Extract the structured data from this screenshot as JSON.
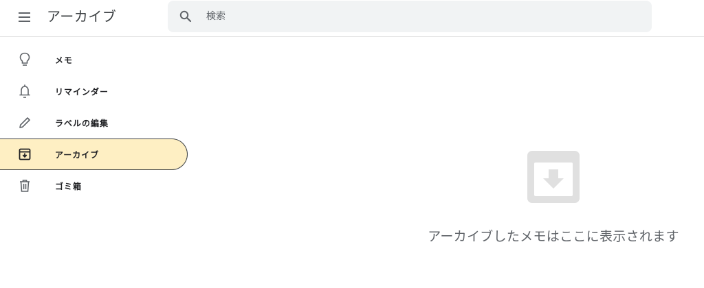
{
  "header": {
    "title": "アーカイブ",
    "menu_icon": "hamburger-menu-icon",
    "search": {
      "placeholder": "検索",
      "value": "",
      "icon": "search-icon"
    }
  },
  "sidebar": {
    "items": [
      {
        "label": "メモ",
        "icon": "lightbulb-icon",
        "active": false
      },
      {
        "label": "リマインダー",
        "icon": "bell-icon",
        "active": false
      },
      {
        "label": "ラベルの編集",
        "icon": "pencil-icon",
        "active": false
      },
      {
        "label": "アーカイブ",
        "icon": "archive-icon",
        "active": true
      },
      {
        "label": "ゴミ箱",
        "icon": "trash-icon",
        "active": false
      }
    ]
  },
  "main": {
    "empty_state": {
      "icon": "archive-icon",
      "message": "アーカイブしたメモはここに表示されます"
    }
  },
  "colors": {
    "active_item_bg": "#feefc3",
    "search_bg": "#f1f3f4",
    "empty_icon": "#e0e0e0",
    "secondary_text": "#5f6368"
  }
}
